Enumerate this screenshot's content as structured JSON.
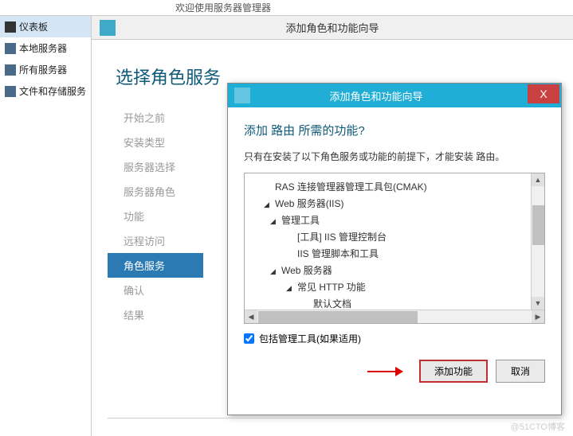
{
  "top": {
    "title": "欢迎使用服务器管理器"
  },
  "sidebar": {
    "items": [
      {
        "label": "仪表板",
        "icon": "dashboard"
      },
      {
        "label": "本地服务器",
        "icon": "server"
      },
      {
        "label": "所有服务器",
        "icon": "allservers"
      },
      {
        "label": "文件和存储服务",
        "icon": "filestore"
      }
    ]
  },
  "main": {
    "header_title": "添加角色和功能向导",
    "wizard_title": "选择角色服务",
    "nav": [
      "开始之前",
      "安装类型",
      "服务器选择",
      "服务器角色",
      "功能",
      "远程访问",
      "角色服务",
      "确认",
      "结果"
    ],
    "nav_active_index": 6
  },
  "modal": {
    "title": "添加角色和功能向导",
    "close": "X",
    "question": "添加 路由 所需的功能?",
    "desc": "只有在安装了以下角色服务或功能的前提下，才能安装 路由。",
    "tree": [
      {
        "level": 0,
        "toggle": "",
        "label": "RAS 连接管理器管理工具包(CMAK)"
      },
      {
        "level": 0,
        "toggle": "◢",
        "label": "Web 服务器(IIS)"
      },
      {
        "level": 1,
        "toggle": "◢",
        "label": "管理工具"
      },
      {
        "level": 2,
        "toggle": "",
        "label": "[工具] IIS 管理控制台"
      },
      {
        "level": 2,
        "toggle": "",
        "label": "IIS 管理脚本和工具"
      },
      {
        "level": 1,
        "toggle": "◢",
        "label": "Web 服务器"
      },
      {
        "level": 2,
        "toggle": "◢",
        "label": "常见 HTTP 功能"
      },
      {
        "level": 3,
        "toggle": "",
        "label": "默认文档"
      }
    ],
    "checkbox_label": "包括管理工具(如果适用)",
    "checkbox_checked": true,
    "btn_add": "添加功能",
    "btn_cancel": "取消"
  },
  "watermark": "@51CTO博客"
}
